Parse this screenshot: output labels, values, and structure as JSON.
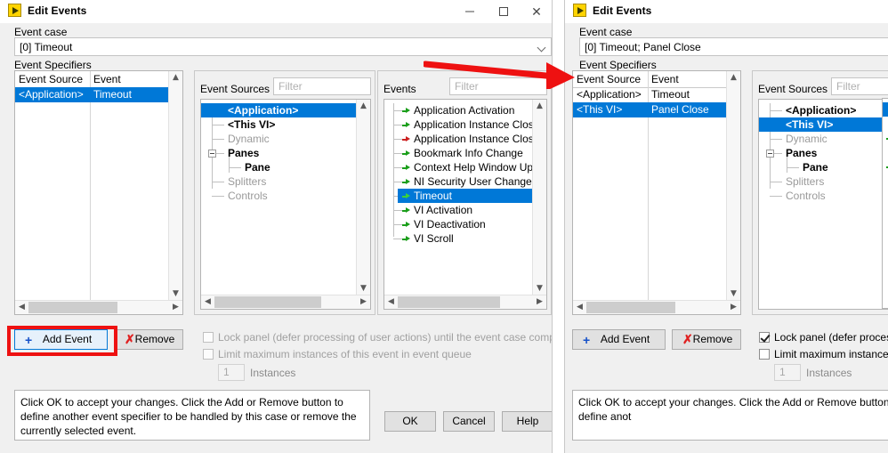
{
  "window_left": {
    "title": "Edit Events",
    "icon": "labview-vi-icon",
    "controls": {
      "minimize": "minimize-icon",
      "maximize": "maximize-icon",
      "close": "close-icon"
    },
    "event_case": {
      "label": "Event case",
      "value": "[0] Timeout"
    },
    "event_specifiers": {
      "label": "Event Specifiers",
      "columns": [
        "Event Source",
        "Event"
      ],
      "rows": [
        {
          "source": "<Application>",
          "event": "Timeout",
          "selected": true
        }
      ]
    },
    "event_sources": {
      "label": "Event Sources",
      "filter_placeholder": "Filter",
      "nodes": [
        {
          "label": "<Application>",
          "indent": 1,
          "style": "bold",
          "selected": true,
          "expander": false
        },
        {
          "label": "<This VI>",
          "indent": 1,
          "style": "bold",
          "selected": false,
          "expander": false
        },
        {
          "label": "Dynamic",
          "indent": 1,
          "style": "gray",
          "selected": false,
          "expander": false
        },
        {
          "label": "Panes",
          "indent": 1,
          "style": "bold",
          "selected": false,
          "expander": true
        },
        {
          "label": "Pane",
          "indent": 2,
          "style": "bold",
          "selected": false,
          "expander": false
        },
        {
          "label": "Splitters",
          "indent": 1,
          "style": "gray",
          "selected": false,
          "expander": false
        },
        {
          "label": "Controls",
          "indent": 1,
          "style": "gray",
          "selected": false,
          "expander": false
        }
      ]
    },
    "events": {
      "label": "Events",
      "filter_placeholder": "Filter",
      "items": [
        {
          "label": "Application Activation",
          "arrow": "green",
          "selected": false
        },
        {
          "label": "Application Instance Close",
          "arrow": "green",
          "selected": false
        },
        {
          "label": "Application Instance Close?",
          "arrow": "red",
          "selected": false
        },
        {
          "label": "Bookmark Info Change",
          "arrow": "green",
          "selected": false
        },
        {
          "label": "Context Help Window Updated",
          "arrow": "green",
          "selected": false
        },
        {
          "label": "NI Security User Change",
          "arrow": "green",
          "selected": false
        },
        {
          "label": "Timeout",
          "arrow": "green",
          "selected": true
        },
        {
          "label": "VI Activation",
          "arrow": "green",
          "selected": false
        },
        {
          "label": "VI Deactivation",
          "arrow": "green",
          "selected": false
        },
        {
          "label": "VI Scroll",
          "arrow": "green",
          "selected": false
        }
      ]
    },
    "add_event_button": "Add Event",
    "remove_button": "Remove",
    "lock_panel": {
      "label": "Lock panel (defer processing of user actions) until the event case completes",
      "checked": false,
      "enabled": false
    },
    "limit_instances": {
      "label": "Limit maximum instances of this event in event queue",
      "checked": false,
      "enabled": false
    },
    "instances": {
      "value": "1",
      "label": "Instances"
    },
    "help_text": "Click OK to accept your changes.  Click the Add or Remove button to define another event specifier to be handled by this case or remove the currently selected event.",
    "ok_button": "OK",
    "cancel_button": "Cancel",
    "help_button": "Help"
  },
  "window_right": {
    "title": "Edit Events",
    "icon": "labview-vi-icon",
    "event_case": {
      "label": "Event case",
      "value": "[0] Timeout;  Panel Close"
    },
    "event_specifiers": {
      "label": "Event Specifiers",
      "columns": [
        "Event Source",
        "Event"
      ],
      "rows": [
        {
          "source": "<Application>",
          "event": "Timeout",
          "selected": false
        },
        {
          "source": "<This VI>",
          "event": "Panel Close",
          "selected": true
        }
      ]
    },
    "event_sources": {
      "label": "Event Sources",
      "filter_placeholder": "Filter",
      "nodes": [
        {
          "label": "<Application>",
          "indent": 1,
          "style": "bold",
          "selected": false,
          "expander": false
        },
        {
          "label": "<This VI>",
          "indent": 1,
          "style": "bold",
          "selected": true,
          "expander": false
        },
        {
          "label": "Dynamic",
          "indent": 1,
          "style": "gray",
          "selected": false,
          "expander": false
        },
        {
          "label": "Panes",
          "indent": 1,
          "style": "bold",
          "selected": false,
          "expander": true
        },
        {
          "label": "Pane",
          "indent": 2,
          "style": "bold",
          "selected": false,
          "expander": false
        },
        {
          "label": "Splitters",
          "indent": 1,
          "style": "gray",
          "selected": false,
          "expander": false
        },
        {
          "label": "Controls",
          "indent": 1,
          "style": "gray",
          "selected": false,
          "expander": false
        }
      ]
    },
    "add_event_button": "Add Event",
    "remove_button": "Remove",
    "lock_panel": {
      "label": "Lock panel (defer processing of",
      "checked": true,
      "enabled": true
    },
    "limit_instances": {
      "label": "Limit maximum instances of th",
      "checked": false,
      "enabled": true
    },
    "instances": {
      "value": "1",
      "label": "Instances"
    },
    "help_text": "Click OK to accept your changes.  Click the Add or Remove button to define anot"
  },
  "annotations": {
    "highlight_box": "add-event-button-highlight",
    "arrow": "pointer-arrow-to-event-specifiers"
  },
  "colors": {
    "selection_blue": "#0078d7",
    "annotation_red": "#ee1111",
    "arrow_green": "#1a9e1a",
    "arrow_red": "#cc2020",
    "window_bg": "#f0f0f0",
    "disabled_text": "#a0a0a0"
  }
}
